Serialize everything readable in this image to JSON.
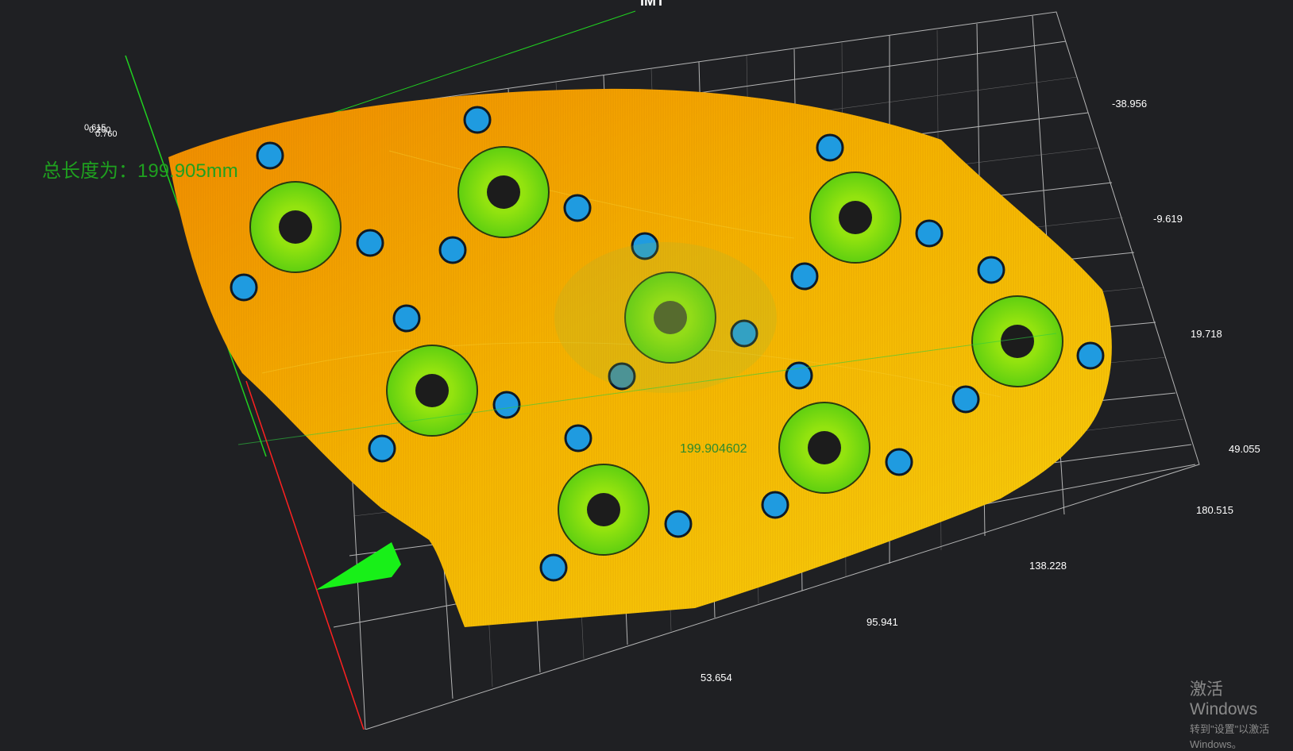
{
  "viewer": {
    "title": "IMT",
    "total_length_label": "总长度为：199.905mm",
    "measurement_value": "199.904602",
    "origin_labels": [
      "0.615",
      "0.200",
      "0.760"
    ]
  },
  "axes": {
    "right_ticks": [
      "-38.956",
      "-9.619",
      "19.718",
      "49.055"
    ],
    "bottom_ticks": [
      "180.515",
      "138.228",
      "95.941",
      "53.654"
    ]
  },
  "watermark": {
    "title": "激活 Windows",
    "subtitle": "转到\"设置\"以激活 Windows。"
  },
  "colors": {
    "background": "#1f2023",
    "part_orange": "#f2a000",
    "part_yellow": "#f7c90a",
    "ring_green": "#7fdc10",
    "hole_blue": "#1f9be0",
    "grid": "#d9d9d9",
    "axis_x": "#ff2020",
    "axis_y": "#20d020",
    "measure_text": "#2e8b2e"
  }
}
